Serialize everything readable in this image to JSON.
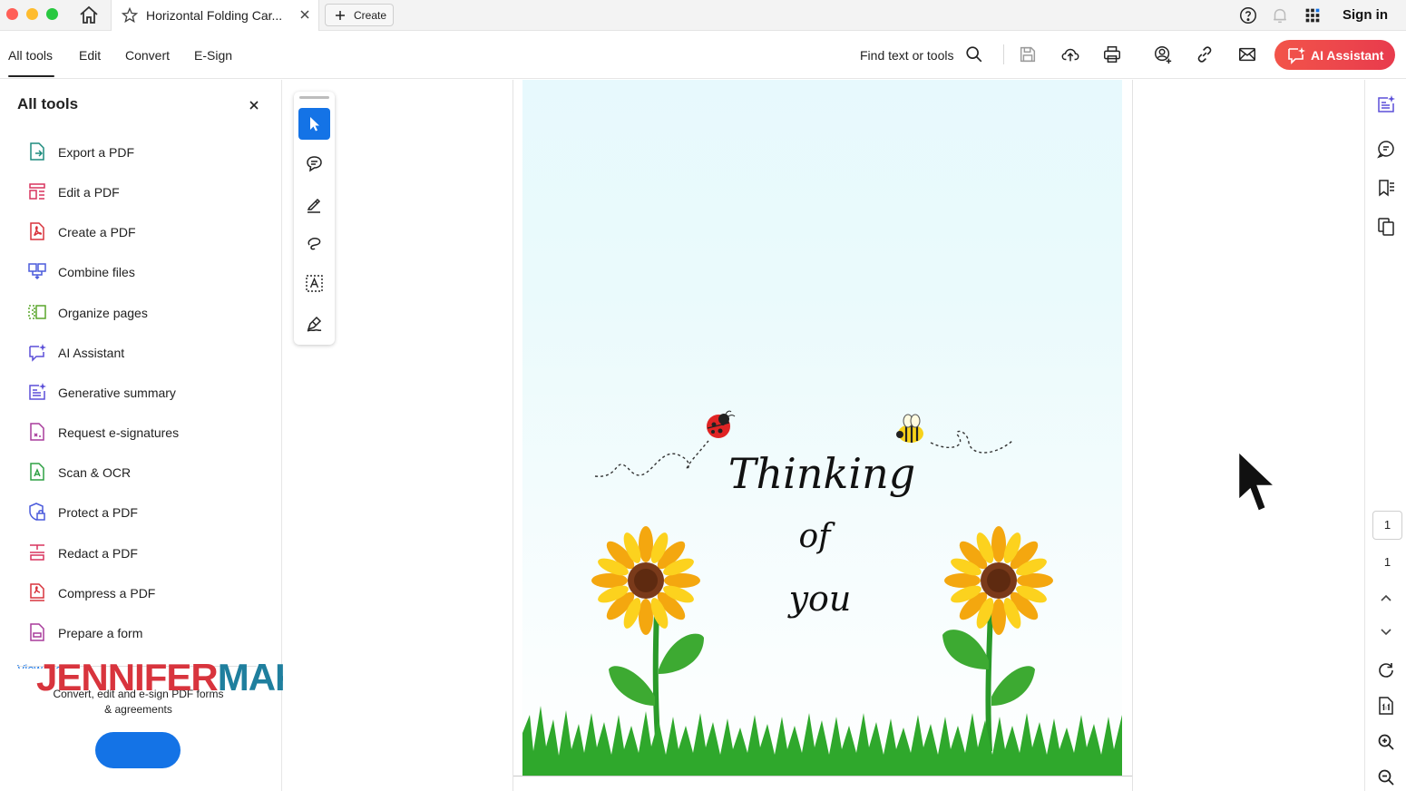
{
  "titlebar": {
    "tab_title": "Horizontal Folding Car...",
    "create_label": "Create",
    "sign_in": "Sign in"
  },
  "menubar": {
    "items": [
      "All tools",
      "Edit",
      "Convert",
      "E-Sign"
    ],
    "active_item": "All tools",
    "find_label": "Find text or tools",
    "ai_assistant_label": "AI Assistant"
  },
  "sidebar": {
    "title": "All tools",
    "tools": [
      {
        "label": "Export a PDF",
        "icon": "export-pdf-icon",
        "color": "#1e8c7e"
      },
      {
        "label": "Edit a PDF",
        "icon": "edit-pdf-icon",
        "color": "#d8345f"
      },
      {
        "label": "Create a PDF",
        "icon": "create-pdf-icon",
        "color": "#d8343d"
      },
      {
        "label": "Combine files",
        "icon": "combine-files-icon",
        "color": "#4b5bdc"
      },
      {
        "label": "Organize pages",
        "icon": "organize-pages-icon",
        "color": "#5aa62b"
      },
      {
        "label": "AI Assistant",
        "icon": "ai-assistant-icon",
        "color": "#5b4fd8"
      },
      {
        "label": "Generative summary",
        "icon": "generative-summary-icon",
        "color": "#5b4fd8"
      },
      {
        "label": "Request e-signatures",
        "icon": "request-esignatures-icon",
        "color": "#a83c9c"
      },
      {
        "label": "Scan & OCR",
        "icon": "scan-ocr-icon",
        "color": "#2ea043"
      },
      {
        "label": "Protect a PDF",
        "icon": "protect-pdf-icon",
        "color": "#4b5bdc"
      },
      {
        "label": "Redact a PDF",
        "icon": "redact-pdf-icon",
        "color": "#d8345f"
      },
      {
        "label": "Compress a PDF",
        "icon": "compress-pdf-icon",
        "color": "#d8343d"
      },
      {
        "label": "Prepare a form",
        "icon": "prepare-form-icon",
        "color": "#a83c9c"
      }
    ],
    "view_more": "View more",
    "promo_text_1": "Convert, edit and e-sign PDF forms",
    "promo_text_2": "& agreements"
  },
  "watermark": {
    "part1": "JENNIFER",
    "part2": "MAKER"
  },
  "document": {
    "line1": "Thinking",
    "line2": "of",
    "line3": "you"
  },
  "page_nav": {
    "current": "1",
    "total": "1"
  },
  "colors": {
    "accent": "#1473e6",
    "ai_button": "#ee4a4c",
    "sunflower_petal": "#f7c20e",
    "sunflower_center": "#7a3a1a",
    "grass": "#2fa82c"
  }
}
